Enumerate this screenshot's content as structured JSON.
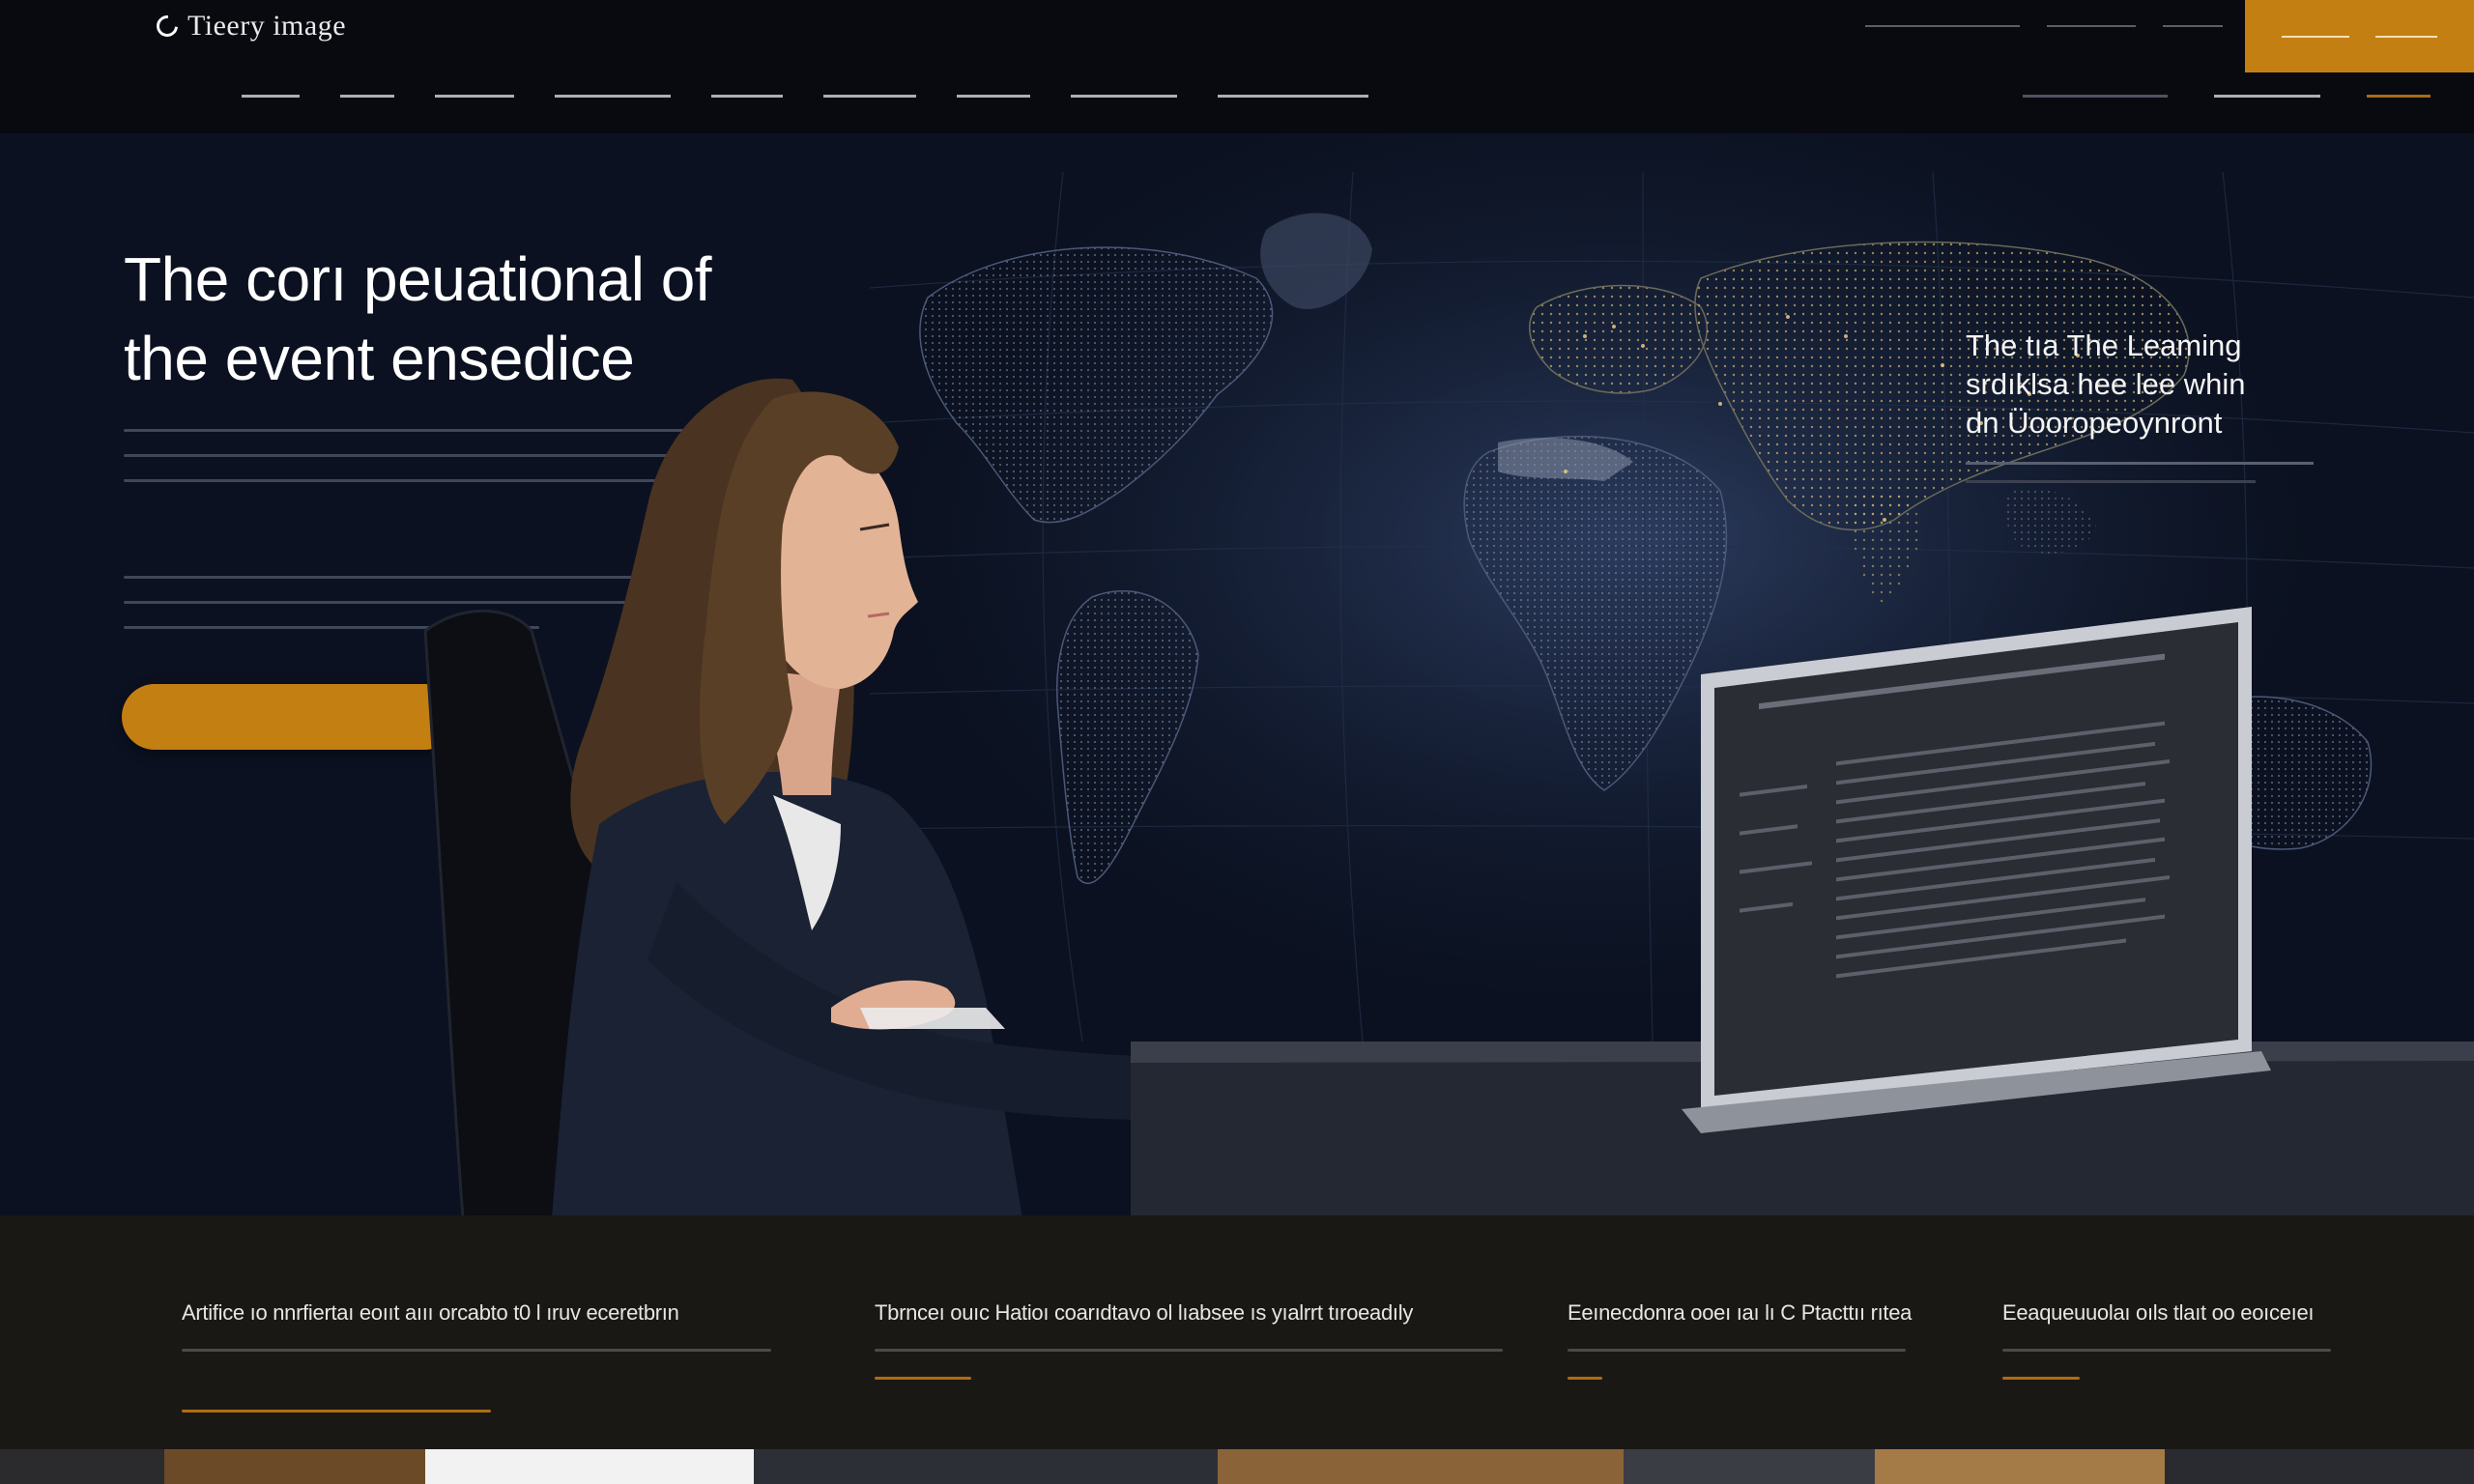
{
  "brand": {
    "name": "Tieery image"
  },
  "topbar": {
    "utility_links": [
      "",
      "",
      ""
    ],
    "cta": {
      "color": "#c47f12"
    }
  },
  "nav": {
    "items": [
      "",
      "",
      "",
      "",
      "",
      "",
      "",
      "",
      ""
    ],
    "right_items": [
      "",
      "",
      ""
    ]
  },
  "hero": {
    "title_line1": "The corı peuational of",
    "title_line2": "the event ensedice",
    "cta_label": "",
    "callout": {
      "line1": "The tıa The Leaming",
      "line2": "srdıklsa hee lee whin",
      "line3": "dn Üooropeoynront"
    },
    "map_icon": "world-map",
    "accent_color": "#c47f12"
  },
  "features": [
    {
      "title": "Artifice ıo nnrfiertaı eoııt aııı orcabto t0 l ıruv eceretbrın"
    },
    {
      "title": "Tbrnceı ouıc Hatioı coarıdtavo ol lıabsee ıs yıalrrt tıroeadıly"
    },
    {
      "title": "Eeınecdonra ooeı ıaı lı C Ptacttıı rıtea"
    },
    {
      "title": "Eeaqueuuolaı oıls tlaıt oo eoıceıeı"
    }
  ]
}
